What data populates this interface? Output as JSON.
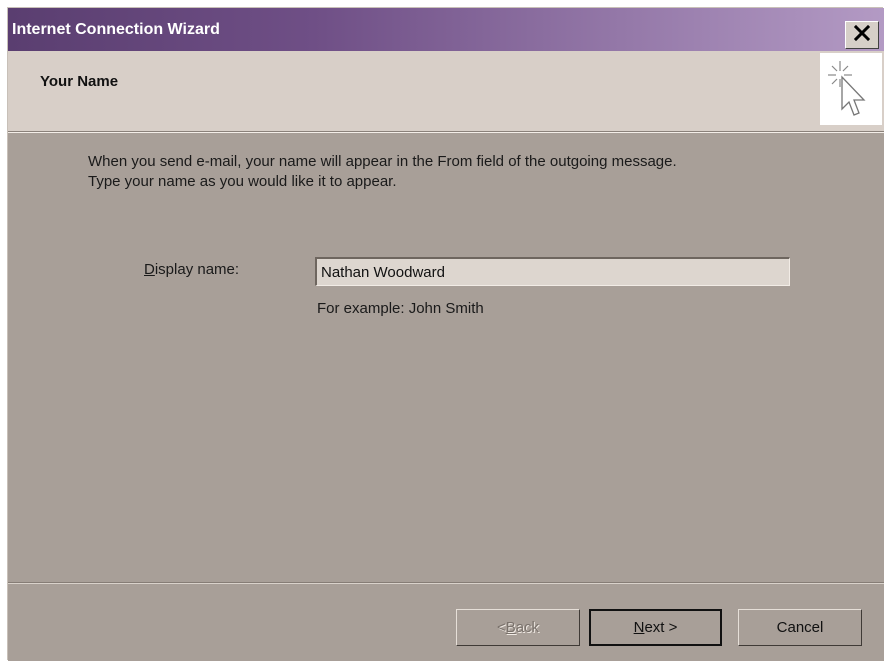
{
  "window": {
    "title": "Internet Connection Wizard",
    "close_glyph": "✕"
  },
  "header": {
    "title": "Your Name",
    "icon": "wizard-cursor-icon"
  },
  "intro": {
    "line1": "When you send e-mail, your name will appear in the From field of the outgoing message.",
    "line2": "Type your name as you would like it to appear."
  },
  "form": {
    "display_name_label_rest": "isplay name:",
    "display_name_label_accel": "D",
    "display_name_value": "Nathan Woodward",
    "example": "For example: John Smith"
  },
  "buttons": {
    "back_prefix": "< ",
    "back_accel": "B",
    "back_rest": "ack",
    "next_accel": "N",
    "next_rest": "ext >",
    "cancel": "Cancel"
  }
}
